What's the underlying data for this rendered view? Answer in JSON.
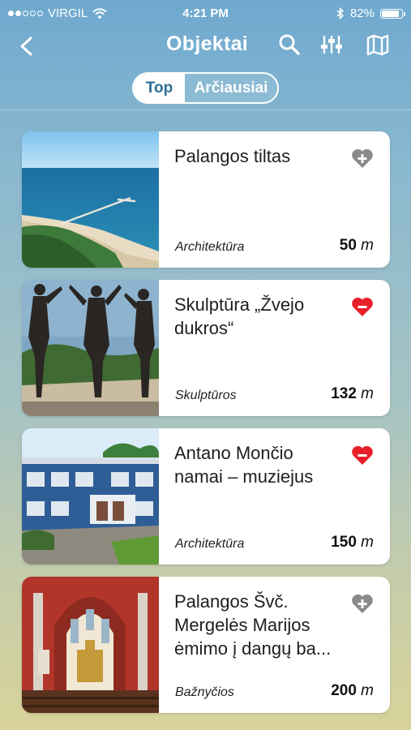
{
  "status_bar": {
    "carrier": "VIRGIL",
    "time": "4:21 PM",
    "battery_percent": "82%",
    "battery_level": 0.82,
    "signal_bars_filled": 2,
    "signal_bars_total": 5
  },
  "nav": {
    "title": "Objektai",
    "back_icon": "chevron-left-icon",
    "actions": [
      "search-icon",
      "filter-sliders-icon",
      "map-icon"
    ]
  },
  "tabs": [
    {
      "label": "Top",
      "active": true
    },
    {
      "label": "Arčiausiai",
      "active": false
    }
  ],
  "colors": {
    "accent": "#2f6e96",
    "favorite_active": "#e8202a",
    "favorite_inactive": "#8a8a8a"
  },
  "items": [
    {
      "title": "Palangos tiltas",
      "category": "Architektūra",
      "distance": "50",
      "unit": "m",
      "favorite": false,
      "image": "pier-over-sea-image"
    },
    {
      "title": "Skulptūra „Žvejo dukros“",
      "category": "Skulptūros",
      "distance": "132",
      "unit": "m",
      "favorite": true,
      "image": "bronze-sculpture-image"
    },
    {
      "title": "Antano Mončio namai – muziejus",
      "category": "Architektūra",
      "distance": "150",
      "unit": "m",
      "favorite": true,
      "image": "blue-house-museum-image"
    },
    {
      "title": "Palangos Švč. Mergelės Marijos ėmimo į dangų ba...",
      "category": "Bažnyčios",
      "distance": "200",
      "unit": "m",
      "favorite": false,
      "image": "church-interior-image"
    }
  ]
}
